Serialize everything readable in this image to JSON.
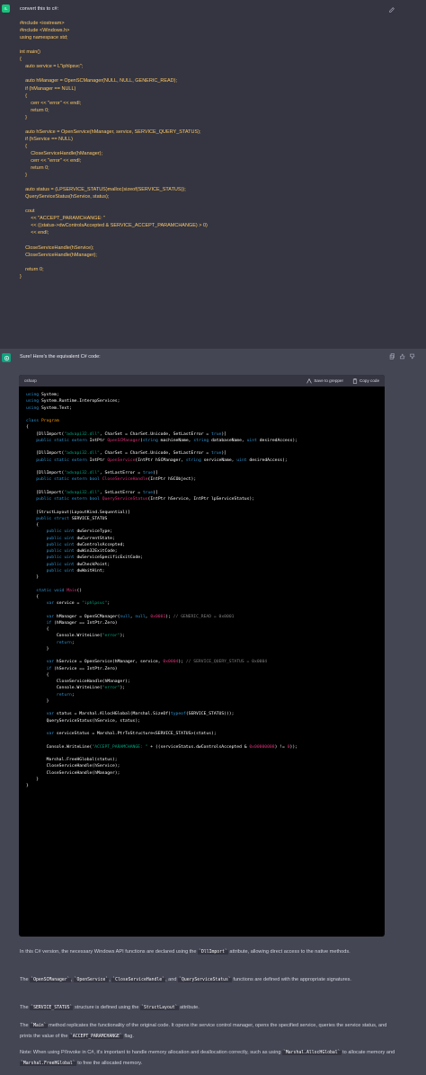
{
  "user": {
    "avatar_text": "rL",
    "lines": [
      "convert this to c#:",
      "",
      "#include <iostream>",
      "#include <Windows.h>",
      "using namespace std;",
      "",
      "int main()",
      "{",
      "    auto service = L\"iphlpsvc\";",
      "",
      "    auto hManager = OpenSCManager(NULL, NULL, GENERIC_READ);",
      "    if (hManager == NULL)",
      "    {",
      "        cerr << \"error\" << endl;",
      "        return 0;",
      "    }",
      "",
      "    auto hService = OpenService(hManager, service, SERVICE_QUERY_STATUS);",
      "    if (hService == NULL)",
      "    {",
      "        CloseServiceHandle(hManager);",
      "        cerr << \"error\" << endl;",
      "        return 0;",
      "    }",
      "",
      "    auto status = (LPSERVICE_STATUS)malloc(sizeof(SERVICE_STATUS));",
      "    QueryServiceStatus(hService, status);",
      "",
      "    cout",
      "        << \"ACCEPT_PARAMCHANGE: \"",
      "        << ((status->dwControlsAccepted & SERVICE_ACCEPT_PARAMCHANGE) > 0)",
      "        << endl;",
      "",
      "    CloseServiceHandle(hService);",
      "    CloseServiceHandle(hManager);",
      "",
      "    return 0;",
      "}"
    ]
  },
  "assistant": {
    "intro": "Sure! Here's the equivalent C# code:",
    "code": {
      "language": "csharp",
      "save_label": "Save to grepper",
      "copy_label": "Copy code"
    },
    "paragraphs": {
      "p1_a": "In this C# version, the necessary Windows API functions are declared using the ",
      "p1_code": "`DllImport`",
      "p1_b": " attribute, allowing direct access to the native methods.",
      "p2_code1": "`OpenSCManager`",
      "p2_code2": "`OpenService`",
      "p2_code3": "`CloseServiceHandle`",
      "p2_code4": "`QueryServiceStatus`",
      "p2_a": "The ",
      "p2_b": ", ",
      "p2_c": ", ",
      "p2_d": ", and ",
      "p2_e": " functions are defined with the appropriate signatures.",
      "p3_a": "The ",
      "p3_code1": "`SERVICE_STATUS`",
      "p3_b": " structure is defined using the ",
      "p3_code2": "`StructLayout`",
      "p3_c": " attribute.",
      "p4_a": "The ",
      "p4_code1": "`Main`",
      "p4_b": " method replicates the functionality of the original code. It opens the service control manager, opens the specified service, queries the service status, and prints the value of the ",
      "p4_code2": "`ACCEPT_PARAMCHANGE`",
      "p4_c": " flag.",
      "p5_a": "Note: When using P/Invoke in C#, it's important to handle memory allocation and deallocation correctly, such as using ",
      "p5_code1": "`Marshal.AllocHGlobal`",
      "p5_b": " to allocate memory and ",
      "p5_code2": "`Marshal.FreeHGlobal`",
      "p5_c": " to free the allocated memory."
    }
  },
  "colors": {
    "user_bg": "#343541",
    "assistant_bg": "#444654",
    "code_bg": "#000000",
    "accent_green": "#10a37f",
    "user_text": "#ffc864"
  }
}
